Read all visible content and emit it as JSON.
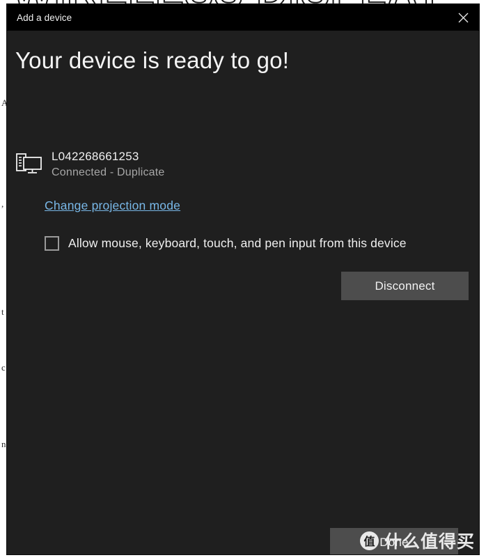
{
  "background": {
    "headline_fragment": "WIRELESS DISPLAY",
    "side_fragments": [
      "A",
      ",",
      "t",
      "c",
      "n"
    ]
  },
  "dialog": {
    "titlebar": {
      "title": "Add a device",
      "close_icon": "close-icon"
    },
    "heading": "Your device is ready to go!",
    "device": {
      "icon": "project-to-second-screen-icon",
      "name": "L042268661253",
      "status": "Connected - Duplicate"
    },
    "projection_link": "Change projection mode",
    "input_permission": {
      "checked": false,
      "label": "Allow mouse, keyboard, touch, and pen input from this device"
    },
    "buttons": {
      "disconnect": "Disconnect",
      "done": "Done"
    }
  },
  "watermark": {
    "logo_char": "值",
    "text": "什么值得买"
  },
  "colors": {
    "titlebar_bg": "#000000",
    "dialog_bg": "#1f1f1f",
    "button_bg": "#4d4d4d",
    "link": "#79b8e8",
    "status_text": "#a7a7a7",
    "primary_text": "#f0f0f0"
  }
}
